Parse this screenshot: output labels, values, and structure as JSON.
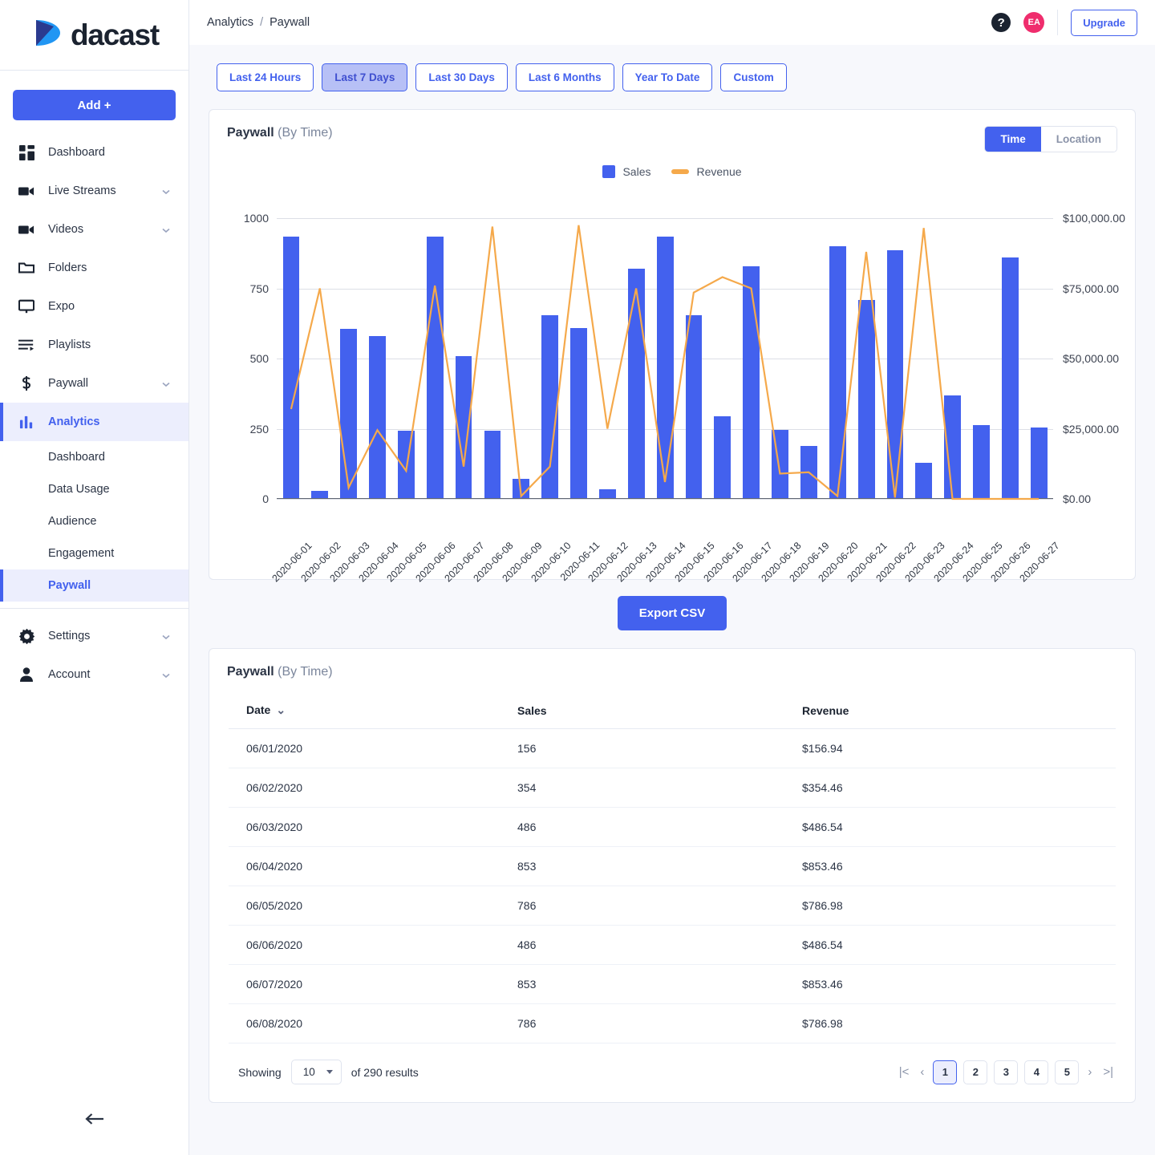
{
  "brand": {
    "name": "dacast",
    "accent": "#4361ee"
  },
  "sidebar": {
    "add_button": "Add +",
    "items": [
      {
        "label": "Dashboard",
        "icon": "grid-icon",
        "chevron": false
      },
      {
        "label": "Live Streams",
        "icon": "video-camera-icon",
        "chevron": true
      },
      {
        "label": "Videos",
        "icon": "video-camera-icon",
        "chevron": true
      },
      {
        "label": "Folders",
        "icon": "folder-icon",
        "chevron": false
      },
      {
        "label": "Expo",
        "icon": "monitor-icon",
        "chevron": false
      },
      {
        "label": "Playlists",
        "icon": "playlist-icon",
        "chevron": false
      },
      {
        "label": "Paywall",
        "icon": "dollar-icon",
        "chevron": true
      },
      {
        "label": "Analytics",
        "icon": "bar-chart-icon",
        "chevron": false,
        "active": true
      }
    ],
    "subitems": [
      {
        "label": "Dashboard"
      },
      {
        "label": "Data Usage"
      },
      {
        "label": "Audience"
      },
      {
        "label": "Engagement"
      },
      {
        "label": "Paywall",
        "active": true
      }
    ],
    "bottom_items": [
      {
        "label": "Settings",
        "icon": "gear-icon",
        "chevron": true
      },
      {
        "label": "Account",
        "icon": "person-icon",
        "chevron": true
      }
    ],
    "collapse_icon": "arrow-left-icon"
  },
  "topbar": {
    "breadcrumb_root": "Analytics",
    "breadcrumb_sep": "/",
    "breadcrumb_current": "Paywall",
    "help_label": "?",
    "avatar_initials": "EA",
    "upgrade_label": "Upgrade"
  },
  "range_filters": {
    "options": [
      "Last 24 Hours",
      "Last 7 Days",
      "Last 30 Days",
      "Last 6 Months",
      "Year To Date",
      "Custom"
    ],
    "selected": "Last 7 Days"
  },
  "chart_card": {
    "title": "Paywall",
    "subtitle": "(By Time)",
    "toggle": {
      "options": [
        "Time",
        "Location"
      ],
      "selected": "Time"
    }
  },
  "export": {
    "label": "Export CSV"
  },
  "table_card": {
    "title": "Paywall",
    "subtitle": "(By Time)",
    "columns": [
      "Date",
      "Sales",
      "Revenue"
    ],
    "sort_column": "Date",
    "rows": [
      {
        "date": "06/01/2020",
        "sales": "156",
        "revenue": "$156.94"
      },
      {
        "date": "06/02/2020",
        "sales": "354",
        "revenue": "$354.46"
      },
      {
        "date": "06/03/2020",
        "sales": "486",
        "revenue": "$486.54"
      },
      {
        "date": "06/04/2020",
        "sales": "853",
        "revenue": "$853.46"
      },
      {
        "date": "06/05/2020",
        "sales": "786",
        "revenue": "$786.98"
      },
      {
        "date": "06/06/2020",
        "sales": "486",
        "revenue": "$486.54"
      },
      {
        "date": "06/07/2020",
        "sales": "853",
        "revenue": "$853.46"
      },
      {
        "date": "06/08/2020",
        "sales": "786",
        "revenue": "$786.98"
      }
    ],
    "footer": {
      "showing_label": "Showing",
      "page_size": "10",
      "results_label": "of 290 results",
      "pages": [
        "1",
        "2",
        "3",
        "4",
        "5"
      ],
      "current_page": "1",
      "first_icon": "|<",
      "prev_icon": "‹",
      "next_icon": "›",
      "last_icon": ">|"
    }
  },
  "chart_data": {
    "type": "bar",
    "title": "Paywall (By Time)",
    "xlabel": "",
    "ylabel": "Sales",
    "y2label": "Revenue",
    "ylim": [
      0,
      1000
    ],
    "y2lim": [
      0,
      100000
    ],
    "yticks": [
      "0",
      "250",
      "500",
      "750",
      "1000"
    ],
    "y2ticks": [
      "$0.00",
      "$25,000.00",
      "$50,000.00",
      "$75,000.00",
      "$100,000.00"
    ],
    "grid": true,
    "legend": [
      "Sales",
      "Revenue"
    ],
    "legend_position": "top-center",
    "colors": {
      "sales": "#4361ee",
      "revenue": "#f5a councilb"
    },
    "categories": [
      "2020-06-01",
      "2020-06-02",
      "2020-06-03",
      "2020-06-04",
      "2020-06-05",
      "2020-06-06",
      "2020-06-07",
      "2020-06-08",
      "2020-06-09",
      "2020-06-10",
      "2020-06-11",
      "2020-06-12",
      "2020-06-13",
      "2020-06-14",
      "2020-06-15",
      "2020-06-16",
      "2020-06-17",
      "2020-06-18",
      "2020-06-19",
      "2020-06-20",
      "2020-06-21",
      "2020-06-22",
      "2020-06-23",
      "2020-06-24",
      "2020-06-25",
      "2020-06-26",
      "2020-06-27"
    ],
    "series": [
      {
        "name": "Sales",
        "type": "bar",
        "axis": "left",
        "values": [
          935,
          30,
          605,
          580,
          243,
          935,
          508,
          243,
          72,
          655,
          610,
          35,
          820,
          935,
          655,
          295,
          828,
          245,
          188,
          900,
          710,
          885,
          130,
          370,
          262,
          860,
          255
        ]
      },
      {
        "name": "Revenue",
        "type": "line",
        "axis": "right",
        "values": [
          32000,
          75000,
          4000,
          24500,
          10000,
          76000,
          11500,
          97000,
          1000,
          11500,
          97500,
          25000,
          75000,
          6000,
          73500,
          79000,
          75000,
          9000,
          9500,
          1000,
          88000,
          500,
          96500,
          0,
          0,
          0,
          0
        ]
      }
    ]
  }
}
